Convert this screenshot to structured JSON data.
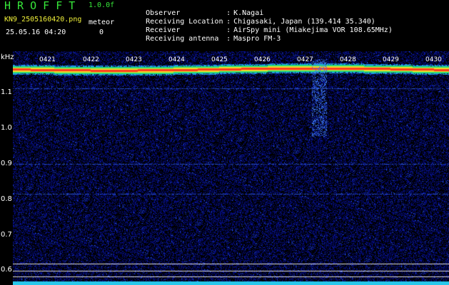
{
  "header": {
    "title": "H R O F F T",
    "version": "1.0.0f",
    "filename": "KN9_2505160420.png",
    "datetime": "25.05.16 04:20",
    "meteor_label": "meteor",
    "meteor_count": "0"
  },
  "meta": [
    {
      "key": "Observer",
      "value": "K.Nagai"
    },
    {
      "key": "Receiving Location",
      "value": "Chigasaki, Japan (139.414 35.340)"
    },
    {
      "key": "Receiver",
      "value": "AirSpy mini (Miakejima VOR 108.65MHz)"
    },
    {
      "key": "Receiving antenna",
      "value": "Maspro FM-3"
    }
  ],
  "spectrogram": {
    "unit": "kHz",
    "y_ticks": [
      "1.1",
      "1.0",
      "0.9",
      "0.8",
      "0.7",
      "0.6"
    ],
    "y_values": [
      1.1,
      1.0,
      0.9,
      0.8,
      0.7,
      0.6
    ],
    "x_ticks": [
      "0421",
      "0422",
      "0423",
      "0424",
      "0425",
      "0426",
      "0427",
      "0428",
      "0429",
      "0430"
    ],
    "carrier_khz": 1.13,
    "colors": {
      "background": "#000000",
      "noise": "#1a2a9a",
      "carrier": "#ff4020",
      "baseline": "#22c8e8"
    }
  }
}
